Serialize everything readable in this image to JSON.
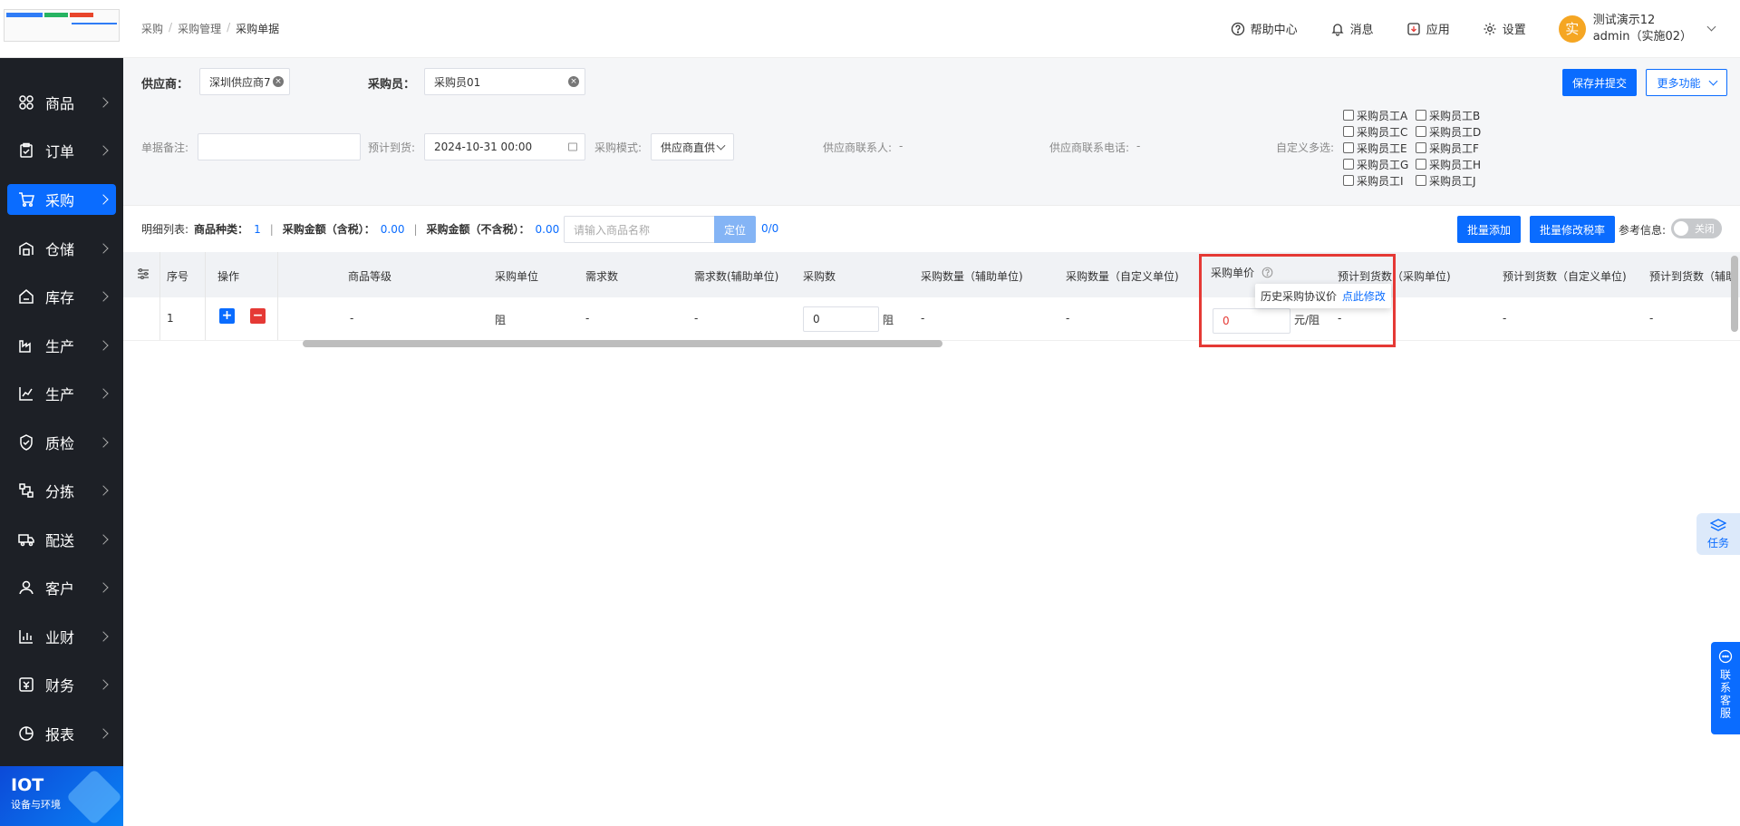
{
  "breadcrumb": {
    "items": [
      "采购",
      "采购管理",
      "采购单据"
    ]
  },
  "header": {
    "help": "帮助中心",
    "messages": "消息",
    "apps": "应用",
    "settings": "设置",
    "user_avatar": "实",
    "user_name": "测试演示12",
    "user_account": "admin（实施02）"
  },
  "sidebar": {
    "items": [
      {
        "label": "商品",
        "icon": "grid-icon"
      },
      {
        "label": "订单",
        "icon": "clipboard-icon"
      },
      {
        "label": "采购",
        "icon": "cart-icon",
        "active": true
      },
      {
        "label": "仓储",
        "icon": "warehouse-icon"
      },
      {
        "label": "库存",
        "icon": "house-icon"
      },
      {
        "label": "生产",
        "icon": "factory-icon"
      },
      {
        "label": "生产",
        "icon": "chart-icon"
      },
      {
        "label": "质检",
        "icon": "shield-icon"
      },
      {
        "label": "分拣",
        "icon": "sort-icon"
      },
      {
        "label": "配送",
        "icon": "truck-icon"
      },
      {
        "label": "客户",
        "icon": "user-icon"
      },
      {
        "label": "业财",
        "icon": "bar-chart-icon"
      },
      {
        "label": "财务",
        "icon": "finance-icon"
      },
      {
        "label": "报表",
        "icon": "report-icon"
      }
    ],
    "banner_title": "IOT",
    "banner_subtitle": "设备与环境"
  },
  "form": {
    "supplier_label": "供应商：",
    "supplier_value": "深圳供应商7",
    "buyer_label": "采购员：",
    "buyer_value": "采购员01",
    "save_submit": "保存并提交",
    "more_functions": "更多功能",
    "note_label": "单据备注:",
    "note_value": "",
    "eta_label": "预计到货:",
    "eta_value": "2024-10-31 00:00",
    "mode_label": "采购模式:",
    "mode_value": "供应商直供",
    "contact_label": "供应商联系人:",
    "contact_value": "-",
    "phone_label": "供应商联系电话:",
    "phone_value": "-",
    "custom_multi_label": "自定义多选:",
    "custom_options": [
      [
        "采购员工A",
        "采购员工B"
      ],
      [
        "采购员工C",
        "采购员工D"
      ],
      [
        "采购员工E",
        "采购员工F"
      ],
      [
        "采购员工G",
        "采购员工H"
      ],
      [
        "采购员工I",
        "采购员工J"
      ]
    ]
  },
  "summary": {
    "list_label": "明细列表:",
    "types_label": "商品种类：",
    "types_value": "1",
    "amount_tax_label": "采购金额（含税）：",
    "amount_tax_value": "0.00",
    "amount_notax_label": "采购金额（不含税）：",
    "amount_notax_value": "0.00",
    "search_placeholder": "请输入商品名称",
    "locate": "定位",
    "locate_count": "0/0",
    "batch_add": "批量添加",
    "batch_tax": "批量修改税率",
    "ref_info_label": "参考信息:",
    "ref_toggle": "关闭"
  },
  "table": {
    "headers": {
      "seq": "序号",
      "op": "操作",
      "grade": "商品等级",
      "unit": "采购单位",
      "demand": "需求数",
      "demand_aux": "需求数(辅助单位)",
      "qty": "采购数",
      "qty_aux": "采购数量（辅助单位)",
      "qty_custom": "采购数量（自定义单位)",
      "price": "采购单价",
      "eta_qty": "预计到货数（采购单位)",
      "eta_qty_custom": "预计到货数（自定义单位)",
      "eta_qty_aux": "预计到货数（辅助"
    },
    "row": {
      "seq": "1",
      "grade": "-",
      "unit": "阻",
      "demand": "-",
      "demand_aux": "-",
      "qty": "0",
      "qty_unit": "阻",
      "qty_aux": "-",
      "qty_custom": "-",
      "price": "0",
      "price_unit": "元/阻",
      "eta_qty": "-",
      "eta_qty_custom": "-",
      "eta_qty_aux": "-"
    },
    "tooltip_text": "历史采购协议价",
    "tooltip_link": "点此修改"
  },
  "floaters": {
    "task": "任务",
    "service": "联系客服"
  }
}
